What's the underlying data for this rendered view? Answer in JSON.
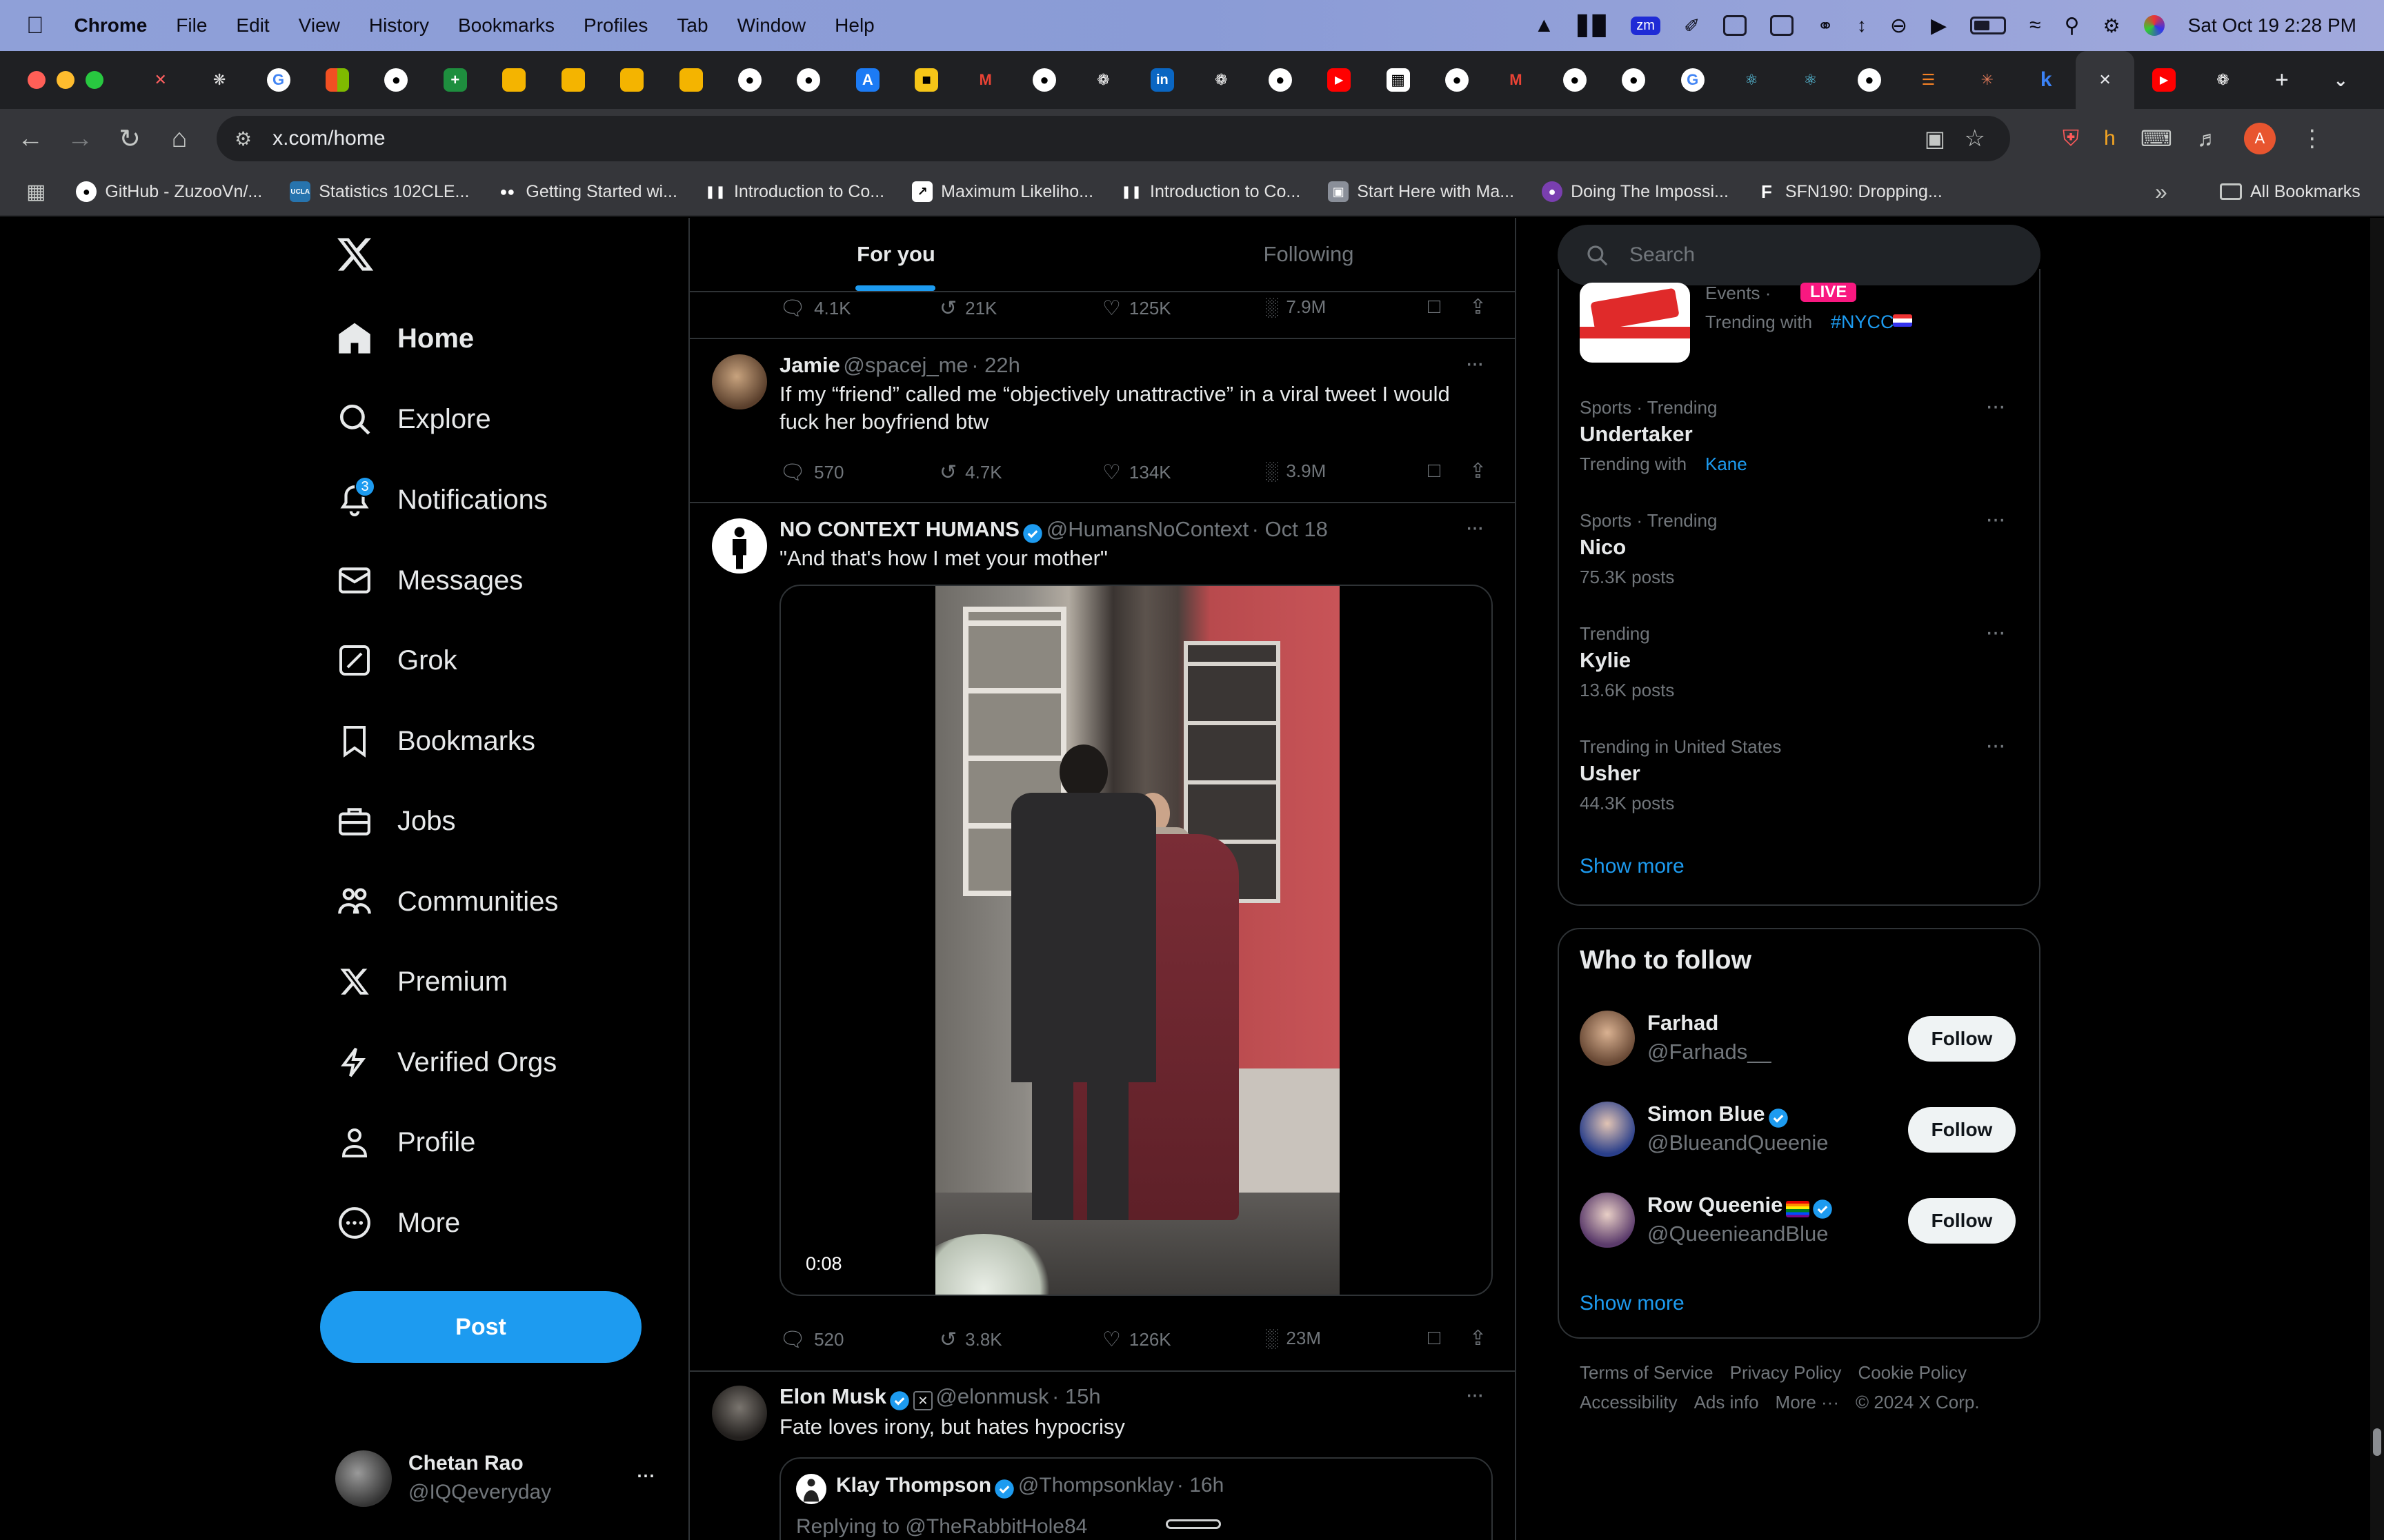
{
  "menubar": {
    "app": "Chrome",
    "items": [
      "File",
      "Edit",
      "View",
      "History",
      "Bookmarks",
      "Profiles",
      "Tab",
      "Window",
      "Help"
    ],
    "clock": "Sat Oct 19  2:28 PM",
    "zm_label": "zm"
  },
  "toolbar": {
    "url": "x.com/home",
    "profile_initial": "A"
  },
  "tabs": {
    "new_tab": "+",
    "linkedin_letter": "in",
    "k_letter": "k"
  },
  "bookmarks": [
    {
      "label": "GitHub - ZuzooVn/...",
      "icon": "github-icon"
    },
    {
      "label": "Statistics 102CLE...",
      "icon": "ucla-icon",
      "badge": "UCLA"
    },
    {
      "label": "Getting Started wi...",
      "icon": "glasses-icon"
    },
    {
      "label": "Introduction to Co...",
      "icon": "bars-icon"
    },
    {
      "label": "Maximum Likeliho...",
      "icon": "chart-icon"
    },
    {
      "label": "Introduction to Co...",
      "icon": "bars-icon"
    },
    {
      "label": "Start Here with Ma...",
      "icon": "course-icon"
    },
    {
      "label": "Doing The Impossi...",
      "icon": "circle-logo-icon"
    },
    {
      "label": "SFN190: Dropping...",
      "icon": "f-letter-icon",
      "badge": "F"
    }
  ],
  "all_bookmarks": "All Bookmarks",
  "nav": {
    "items": [
      {
        "label": "Home",
        "icon": "home-icon"
      },
      {
        "label": "Explore",
        "icon": "search-icon"
      },
      {
        "label": "Notifications",
        "icon": "bell-icon",
        "badge": "3"
      },
      {
        "label": "Messages",
        "icon": "envelope-icon"
      },
      {
        "label": "Grok",
        "icon": "grok-icon"
      },
      {
        "label": "Bookmarks",
        "icon": "bookmark-icon"
      },
      {
        "label": "Jobs",
        "icon": "briefcase-icon"
      },
      {
        "label": "Communities",
        "icon": "communities-icon"
      },
      {
        "label": "Premium",
        "icon": "x-logo-icon"
      },
      {
        "label": "Verified Orgs",
        "icon": "lightning-icon"
      },
      {
        "label": "Profile",
        "icon": "person-icon"
      },
      {
        "label": "More",
        "icon": "more-circle-icon"
      }
    ],
    "post_label": "Post",
    "account": {
      "name": "Chetan Rao",
      "handle": "@IQQeveryday"
    }
  },
  "feed_tabs": {
    "for_you": "For you",
    "following": "Following"
  },
  "tweets": [
    {
      "stats": {
        "replies": "4.1K",
        "reposts": "21K",
        "likes": "125K",
        "views": "7.9M"
      }
    },
    {
      "name": "Jamie",
      "handle": "@spacej_me",
      "time": "· 22h",
      "text": "If my “friend” called me “objectively unattractive” in a viral tweet I would fuck her boyfriend btw",
      "stats": {
        "replies": "570",
        "reposts": "4.7K",
        "likes": "134K",
        "views": "3.9M"
      }
    },
    {
      "name": "NO CONTEXT HUMANS",
      "handle": "@HumansNoContext",
      "time": "· Oct 18",
      "text": "\"And that's how I met your mother\"",
      "video_time": "0:08",
      "stats": {
        "replies": "520",
        "reposts": "3.8K",
        "likes": "126K",
        "views": "23M"
      }
    },
    {
      "name": "Elon Musk",
      "handle": "@elonmusk",
      "time": "· 15h",
      "text": "Fate loves irony, but hates hypocrisy",
      "quote": {
        "name": "Klay Thompson",
        "handle": "@Thompsonklay",
        "time": "· 16h",
        "text": "Replying to @TheRabbitHole84"
      }
    }
  ],
  "search": {
    "placeholder": "Search"
  },
  "trending": {
    "top": {
      "category": "Events ·",
      "live": "LIVE",
      "trending_with": "Trending with",
      "tag": "#NYCC"
    },
    "items": [
      {
        "category": "Sports · Trending",
        "title": "Undertaker",
        "sub_prefix": "Trending with",
        "sub_link": "Kane"
      },
      {
        "category": "Sports · Trending",
        "title": "Nico",
        "sub": "75.3K posts"
      },
      {
        "category": "Trending",
        "title": "Kylie",
        "sub": "13.6K posts"
      },
      {
        "category": "Trending in United States",
        "title": "Usher",
        "sub": "44.3K posts"
      }
    ],
    "show_more": "Show more"
  },
  "who_to_follow": {
    "title": "Who to follow",
    "people": [
      {
        "name": "Farhad",
        "handle": "@Farhads__",
        "verified": false
      },
      {
        "name": "Simon Blue",
        "handle": "@BlueandQueenie",
        "verified": true
      },
      {
        "name": "Row Queenie",
        "handle": "@QueenieandBlue",
        "verified": true
      }
    ],
    "follow_label": "Follow",
    "show_more": "Show more"
  },
  "footer": {
    "links": [
      "Terms of Service",
      "Privacy Policy",
      "Cookie Policy",
      "Accessibility",
      "Ads info",
      "More ···",
      "© 2024 X Corp."
    ]
  },
  "colors": {
    "accent": "#1d9bf0",
    "live": "#f91880",
    "bg": "#000000"
  }
}
